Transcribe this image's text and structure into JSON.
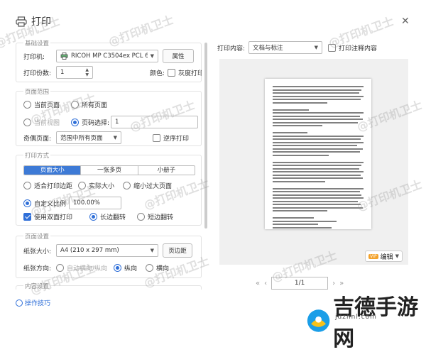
{
  "title": "打印",
  "basic": {
    "group_title": "基础设置",
    "printer_label": "打印机:",
    "printer_value": "RICOH MP C3504ex PCL 6",
    "props_btn": "属性",
    "copies_label": "打印份数:",
    "copies_value": "1",
    "color_label": "颜色:",
    "gray_label": "灰度打印"
  },
  "range": {
    "group_title": "页面范围",
    "current_page": "当前页面",
    "all_pages": "所有页面",
    "current_view": "当前视图",
    "page_select": "页码选择:",
    "page_select_value": "1",
    "odd_even_label": "奇偶页面:",
    "odd_even_value": "范围中所有页面",
    "reverse_label": "逆序打印"
  },
  "mode": {
    "group_title": "打印方式",
    "tabs": [
      "页面大小",
      "一张多页",
      "小册子"
    ],
    "fit_margin": "适合打印边距",
    "actual_size": "实际大小",
    "shrink_big": "缩小过大页面",
    "custom_scale": "自定义比例",
    "scale_value": "100.00%",
    "duplex": "使用双面打印",
    "long_edge": "长边翻转",
    "short_edge": "短边翻转"
  },
  "page": {
    "group_title": "页面设置",
    "paper_size_label": "纸张大小:",
    "paper_size_value": "A4 (210 x 297 mm)",
    "margin_btn": "页边距",
    "orientation_label": "纸张方向:",
    "auto": "自动横向/纵向",
    "portrait": "纵向",
    "landscape": "横向"
  },
  "more": {
    "group_title": "内容设置"
  },
  "preview": {
    "content_label": "打印内容:",
    "content_value": "文档与标注",
    "annot_label": "打印注释内容",
    "edit": "编辑",
    "vip": "VIP",
    "page": "1/1"
  },
  "tips": "操作技巧",
  "watermark": "@打印机卫士",
  "logo": {
    "text": "吉德手游网",
    "url": "jdzhnl.com"
  }
}
